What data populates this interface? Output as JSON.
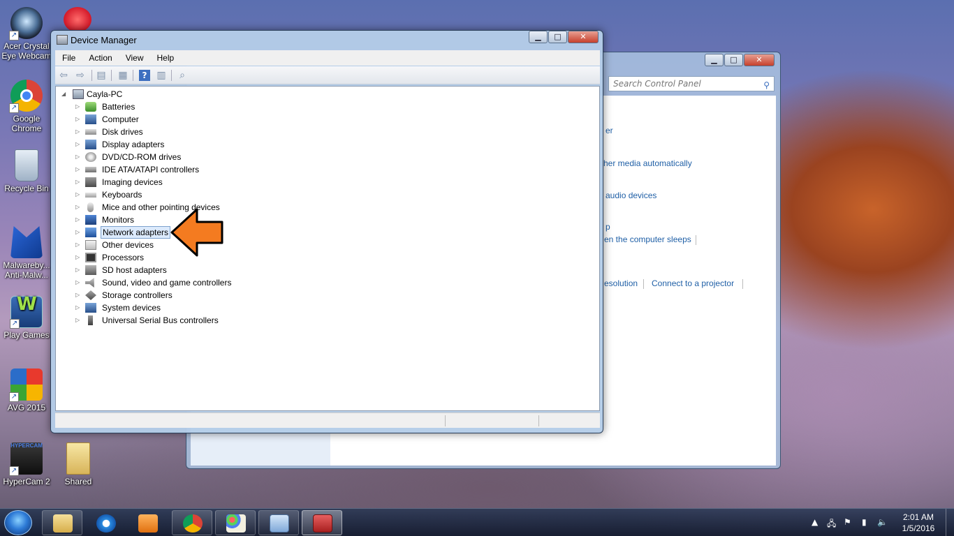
{
  "desktop": {
    "icons": [
      {
        "label": "Acer Crystal Eye Webcam",
        "icon": "webcam-icon"
      },
      {
        "label": "Google Chrome",
        "icon": "chrome-icon"
      },
      {
        "label": "Recycle Bin",
        "icon": "recycle-bin-icon"
      },
      {
        "label": "Malwareby... Anti-Malw...",
        "icon": "malwarebytes-icon"
      },
      {
        "label": "Play Games",
        "icon": "wildtangent-games-icon"
      },
      {
        "label": "AVG 2015",
        "icon": "avg-icon"
      },
      {
        "label": "HyperCam 2",
        "icon": "hypercam-icon"
      },
      {
        "label": "Shared",
        "icon": "folder-icon"
      }
    ]
  },
  "control_panel": {
    "search_placeholder": "Search Control Panel",
    "links": [
      "er",
      "her media automatically",
      "audio devices",
      "p",
      "en the computer sleeps",
      "esolution",
      "Connect to a projector"
    ]
  },
  "device_manager": {
    "title": "Device Manager",
    "menu": [
      "File",
      "Action",
      "View",
      "Help"
    ],
    "root": "Cayla-PC",
    "categories": [
      {
        "label": "Batteries",
        "icon": "battery-icon"
      },
      {
        "label": "Computer",
        "icon": "computer-icon"
      },
      {
        "label": "Disk drives",
        "icon": "disk-drive-icon"
      },
      {
        "label": "Display adapters",
        "icon": "display-adapter-icon"
      },
      {
        "label": "DVD/CD-ROM drives",
        "icon": "dvd-drive-icon"
      },
      {
        "label": "IDE ATA/ATAPI controllers",
        "icon": "ide-controller-icon"
      },
      {
        "label": "Imaging devices",
        "icon": "imaging-device-icon"
      },
      {
        "label": "Keyboards",
        "icon": "keyboard-icon"
      },
      {
        "label": "Mice and other pointing devices",
        "icon": "mouse-icon"
      },
      {
        "label": "Monitors",
        "icon": "monitor-icon"
      },
      {
        "label": "Network adapters",
        "icon": "network-adapter-icon",
        "selected": true
      },
      {
        "label": "Other devices",
        "icon": "unknown-device-icon"
      },
      {
        "label": "Processors",
        "icon": "processor-icon"
      },
      {
        "label": "SD host adapters",
        "icon": "sd-host-icon"
      },
      {
        "label": "Sound, video and game controllers",
        "icon": "speaker-icon"
      },
      {
        "label": "Storage controllers",
        "icon": "storage-controller-icon"
      },
      {
        "label": "System devices",
        "icon": "system-device-icon"
      },
      {
        "label": "Universal Serial Bus controllers",
        "icon": "usb-icon"
      }
    ]
  },
  "taskbar": {
    "clock_time": "2:01 AM",
    "clock_date": "1/5/2016",
    "apps": [
      "windows-explorer-icon",
      "internet-explorer-icon",
      "media-player-icon",
      "chrome-icon",
      "paint-icon",
      "control-panel-icon",
      "device-manager-icon"
    ]
  },
  "colors": {
    "accent_arrow": "#f47b20",
    "selection": "#dceafc",
    "link": "#1f5fa6"
  }
}
